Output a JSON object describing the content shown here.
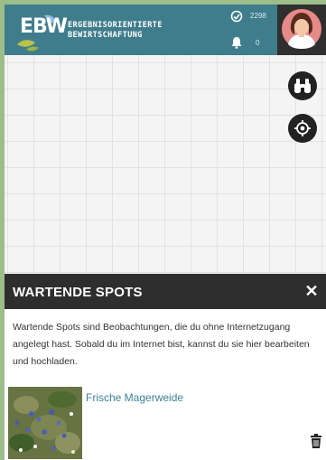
{
  "header": {
    "logo_abbr": "EBW",
    "logo_line1": "ERGEBNISORIENTIERTE",
    "logo_line2": "BEWIRTSCHAFTUNG",
    "points_count": "2298",
    "notifications_count": "0",
    "accent_color": "#3f7d8c"
  },
  "map": {
    "binoculars_icon": "binoculars-icon",
    "locate_icon": "locate-icon"
  },
  "panel": {
    "title": "WARTENDE SPOTS",
    "close_label": "✕",
    "description": "Wartende Spots sind Beobachtungen, die du ohne Internetzugang angelegt hast. Sobald du im Internet bist, kannst du sie hier bearbeiten und hochladen.",
    "spots": [
      {
        "name": "Frische Magerweide",
        "thumbnail_icon": "meadow-photo",
        "delete_icon": "trash-icon"
      }
    ]
  }
}
